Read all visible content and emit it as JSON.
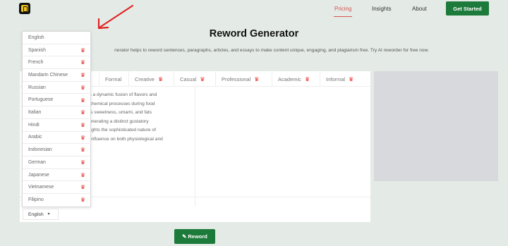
{
  "header": {
    "logo_icon": "paraphraser-logo-icon",
    "nav": [
      "Pricing",
      "Insights",
      "About"
    ],
    "cta": "Get Started",
    "accent": "#d9534f",
    "brand_green": "#1c7a3a"
  },
  "page": {
    "title": "Reword Generator",
    "subtitle": "nerator helps to reword sentences, paragraphs, articles, and essays to make content unique, engaging, and plagiarism free. Try AI reworder for free now."
  },
  "tabs": [
    {
      "label": "Formal",
      "premium": false
    },
    {
      "label": "Creative",
      "premium": true
    },
    {
      "label": "Casual",
      "premium": true
    },
    {
      "label": "Professional",
      "premium": true
    },
    {
      "label": "Academic",
      "premium": true
    },
    {
      "label": "Informal",
      "premium": true
    }
  ],
  "input_lines": [
    "ges a dynamic fusion of flavors and",
    "re chemical processes during food",
    "h as sweetness, umami, and fats",
    ", generating a distinct gustatory",
    "ghlights the sophisticated nature of",
    "nd influence on both physiological and"
  ],
  "languages": [
    {
      "label": "English",
      "premium": false
    },
    {
      "label": "Spanish",
      "premium": true
    },
    {
      "label": "French",
      "premium": true
    },
    {
      "label": "Mandarin Chinese",
      "premium": true
    },
    {
      "label": "Russian",
      "premium": true
    },
    {
      "label": "Portuguese",
      "premium": true
    },
    {
      "label": "Italian",
      "premium": true
    },
    {
      "label": "Hindi",
      "premium": true
    },
    {
      "label": "Arabic",
      "premium": true
    },
    {
      "label": "Indonesian",
      "premium": true
    },
    {
      "label": "German",
      "premium": true
    },
    {
      "label": "Japanese",
      "premium": true
    },
    {
      "label": "Vietnamese",
      "premium": true
    },
    {
      "label": "Filipino",
      "premium": true
    }
  ],
  "language_select": {
    "value": "English"
  },
  "reword_button": {
    "label": "Reword",
    "icon": "pen-icon"
  },
  "annotation": {
    "icon": "red-arrow-icon",
    "color": "#e02424"
  }
}
